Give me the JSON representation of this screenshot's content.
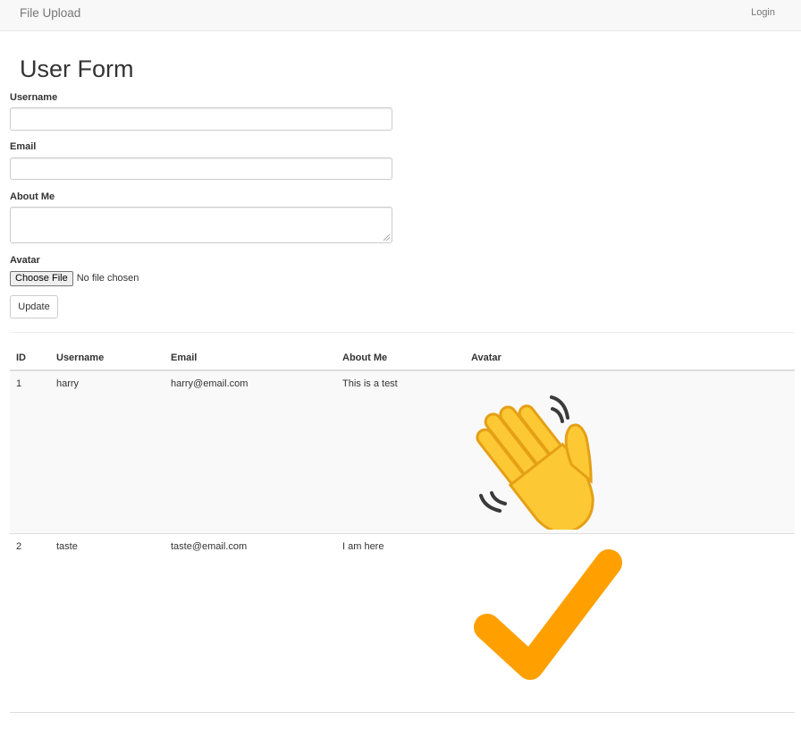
{
  "navbar": {
    "brand": "File Upload",
    "login": "Login"
  },
  "form": {
    "title": "User Form",
    "username_label": "Username",
    "email_label": "Email",
    "about_label": "About Me",
    "avatar_label": "Avatar",
    "choose_file": "Choose File",
    "no_file": "No file chosen",
    "update": "Update"
  },
  "table": {
    "headers": [
      "ID",
      "Username",
      "Email",
      "About Me",
      "Avatar"
    ],
    "rows": [
      {
        "id": "1",
        "username": "harry",
        "email": "harry@email.com",
        "about": "This is a test",
        "avatar": "waving-hand-icon"
      },
      {
        "id": "2",
        "username": "taste",
        "email": "taste@email.com",
        "about": "I am here",
        "avatar": "check-mark-icon"
      }
    ]
  },
  "colors": {
    "accent_yellow": "#FBC02D",
    "check_orange": "#FFA000"
  }
}
